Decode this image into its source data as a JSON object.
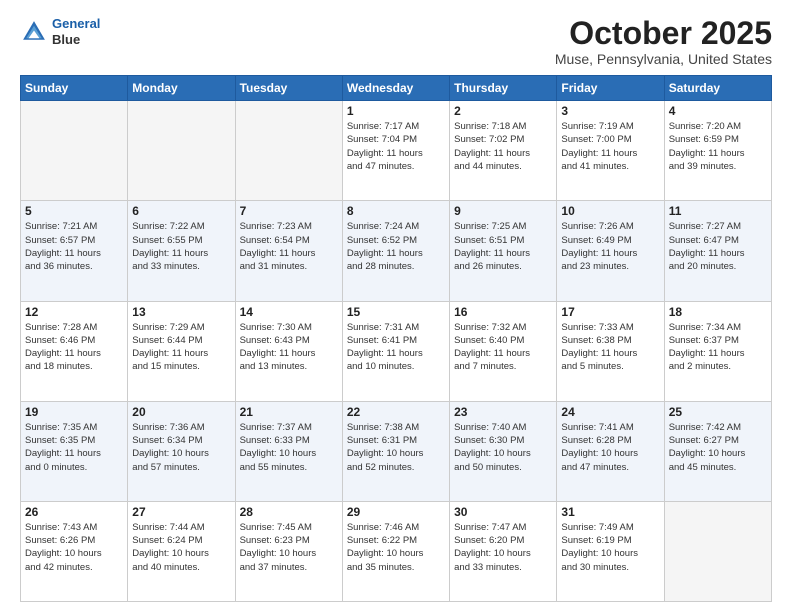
{
  "header": {
    "logo_line1": "General",
    "logo_line2": "Blue",
    "month_title": "October 2025",
    "location": "Muse, Pennsylvania, United States"
  },
  "days_of_week": [
    "Sunday",
    "Monday",
    "Tuesday",
    "Wednesday",
    "Thursday",
    "Friday",
    "Saturday"
  ],
  "weeks": [
    {
      "alt": false,
      "days": [
        {
          "num": "",
          "empty": true,
          "info": ""
        },
        {
          "num": "",
          "empty": true,
          "info": ""
        },
        {
          "num": "",
          "empty": true,
          "info": ""
        },
        {
          "num": "1",
          "empty": false,
          "info": "Sunrise: 7:17 AM\nSunset: 7:04 PM\nDaylight: 11 hours\nand 47 minutes."
        },
        {
          "num": "2",
          "empty": false,
          "info": "Sunrise: 7:18 AM\nSunset: 7:02 PM\nDaylight: 11 hours\nand 44 minutes."
        },
        {
          "num": "3",
          "empty": false,
          "info": "Sunrise: 7:19 AM\nSunset: 7:00 PM\nDaylight: 11 hours\nand 41 minutes."
        },
        {
          "num": "4",
          "empty": false,
          "info": "Sunrise: 7:20 AM\nSunset: 6:59 PM\nDaylight: 11 hours\nand 39 minutes."
        }
      ]
    },
    {
      "alt": true,
      "days": [
        {
          "num": "5",
          "empty": false,
          "info": "Sunrise: 7:21 AM\nSunset: 6:57 PM\nDaylight: 11 hours\nand 36 minutes."
        },
        {
          "num": "6",
          "empty": false,
          "info": "Sunrise: 7:22 AM\nSunset: 6:55 PM\nDaylight: 11 hours\nand 33 minutes."
        },
        {
          "num": "7",
          "empty": false,
          "info": "Sunrise: 7:23 AM\nSunset: 6:54 PM\nDaylight: 11 hours\nand 31 minutes."
        },
        {
          "num": "8",
          "empty": false,
          "info": "Sunrise: 7:24 AM\nSunset: 6:52 PM\nDaylight: 11 hours\nand 28 minutes."
        },
        {
          "num": "9",
          "empty": false,
          "info": "Sunrise: 7:25 AM\nSunset: 6:51 PM\nDaylight: 11 hours\nand 26 minutes."
        },
        {
          "num": "10",
          "empty": false,
          "info": "Sunrise: 7:26 AM\nSunset: 6:49 PM\nDaylight: 11 hours\nand 23 minutes."
        },
        {
          "num": "11",
          "empty": false,
          "info": "Sunrise: 7:27 AM\nSunset: 6:47 PM\nDaylight: 11 hours\nand 20 minutes."
        }
      ]
    },
    {
      "alt": false,
      "days": [
        {
          "num": "12",
          "empty": false,
          "info": "Sunrise: 7:28 AM\nSunset: 6:46 PM\nDaylight: 11 hours\nand 18 minutes."
        },
        {
          "num": "13",
          "empty": false,
          "info": "Sunrise: 7:29 AM\nSunset: 6:44 PM\nDaylight: 11 hours\nand 15 minutes."
        },
        {
          "num": "14",
          "empty": false,
          "info": "Sunrise: 7:30 AM\nSunset: 6:43 PM\nDaylight: 11 hours\nand 13 minutes."
        },
        {
          "num": "15",
          "empty": false,
          "info": "Sunrise: 7:31 AM\nSunset: 6:41 PM\nDaylight: 11 hours\nand 10 minutes."
        },
        {
          "num": "16",
          "empty": false,
          "info": "Sunrise: 7:32 AM\nSunset: 6:40 PM\nDaylight: 11 hours\nand 7 minutes."
        },
        {
          "num": "17",
          "empty": false,
          "info": "Sunrise: 7:33 AM\nSunset: 6:38 PM\nDaylight: 11 hours\nand 5 minutes."
        },
        {
          "num": "18",
          "empty": false,
          "info": "Sunrise: 7:34 AM\nSunset: 6:37 PM\nDaylight: 11 hours\nand 2 minutes."
        }
      ]
    },
    {
      "alt": true,
      "days": [
        {
          "num": "19",
          "empty": false,
          "info": "Sunrise: 7:35 AM\nSunset: 6:35 PM\nDaylight: 11 hours\nand 0 minutes."
        },
        {
          "num": "20",
          "empty": false,
          "info": "Sunrise: 7:36 AM\nSunset: 6:34 PM\nDaylight: 10 hours\nand 57 minutes."
        },
        {
          "num": "21",
          "empty": false,
          "info": "Sunrise: 7:37 AM\nSunset: 6:33 PM\nDaylight: 10 hours\nand 55 minutes."
        },
        {
          "num": "22",
          "empty": false,
          "info": "Sunrise: 7:38 AM\nSunset: 6:31 PM\nDaylight: 10 hours\nand 52 minutes."
        },
        {
          "num": "23",
          "empty": false,
          "info": "Sunrise: 7:40 AM\nSunset: 6:30 PM\nDaylight: 10 hours\nand 50 minutes."
        },
        {
          "num": "24",
          "empty": false,
          "info": "Sunrise: 7:41 AM\nSunset: 6:28 PM\nDaylight: 10 hours\nand 47 minutes."
        },
        {
          "num": "25",
          "empty": false,
          "info": "Sunrise: 7:42 AM\nSunset: 6:27 PM\nDaylight: 10 hours\nand 45 minutes."
        }
      ]
    },
    {
      "alt": false,
      "days": [
        {
          "num": "26",
          "empty": false,
          "info": "Sunrise: 7:43 AM\nSunset: 6:26 PM\nDaylight: 10 hours\nand 42 minutes."
        },
        {
          "num": "27",
          "empty": false,
          "info": "Sunrise: 7:44 AM\nSunset: 6:24 PM\nDaylight: 10 hours\nand 40 minutes."
        },
        {
          "num": "28",
          "empty": false,
          "info": "Sunrise: 7:45 AM\nSunset: 6:23 PM\nDaylight: 10 hours\nand 37 minutes."
        },
        {
          "num": "29",
          "empty": false,
          "info": "Sunrise: 7:46 AM\nSunset: 6:22 PM\nDaylight: 10 hours\nand 35 minutes."
        },
        {
          "num": "30",
          "empty": false,
          "info": "Sunrise: 7:47 AM\nSunset: 6:20 PM\nDaylight: 10 hours\nand 33 minutes."
        },
        {
          "num": "31",
          "empty": false,
          "info": "Sunrise: 7:49 AM\nSunset: 6:19 PM\nDaylight: 10 hours\nand 30 minutes."
        },
        {
          "num": "",
          "empty": true,
          "info": ""
        }
      ]
    }
  ]
}
